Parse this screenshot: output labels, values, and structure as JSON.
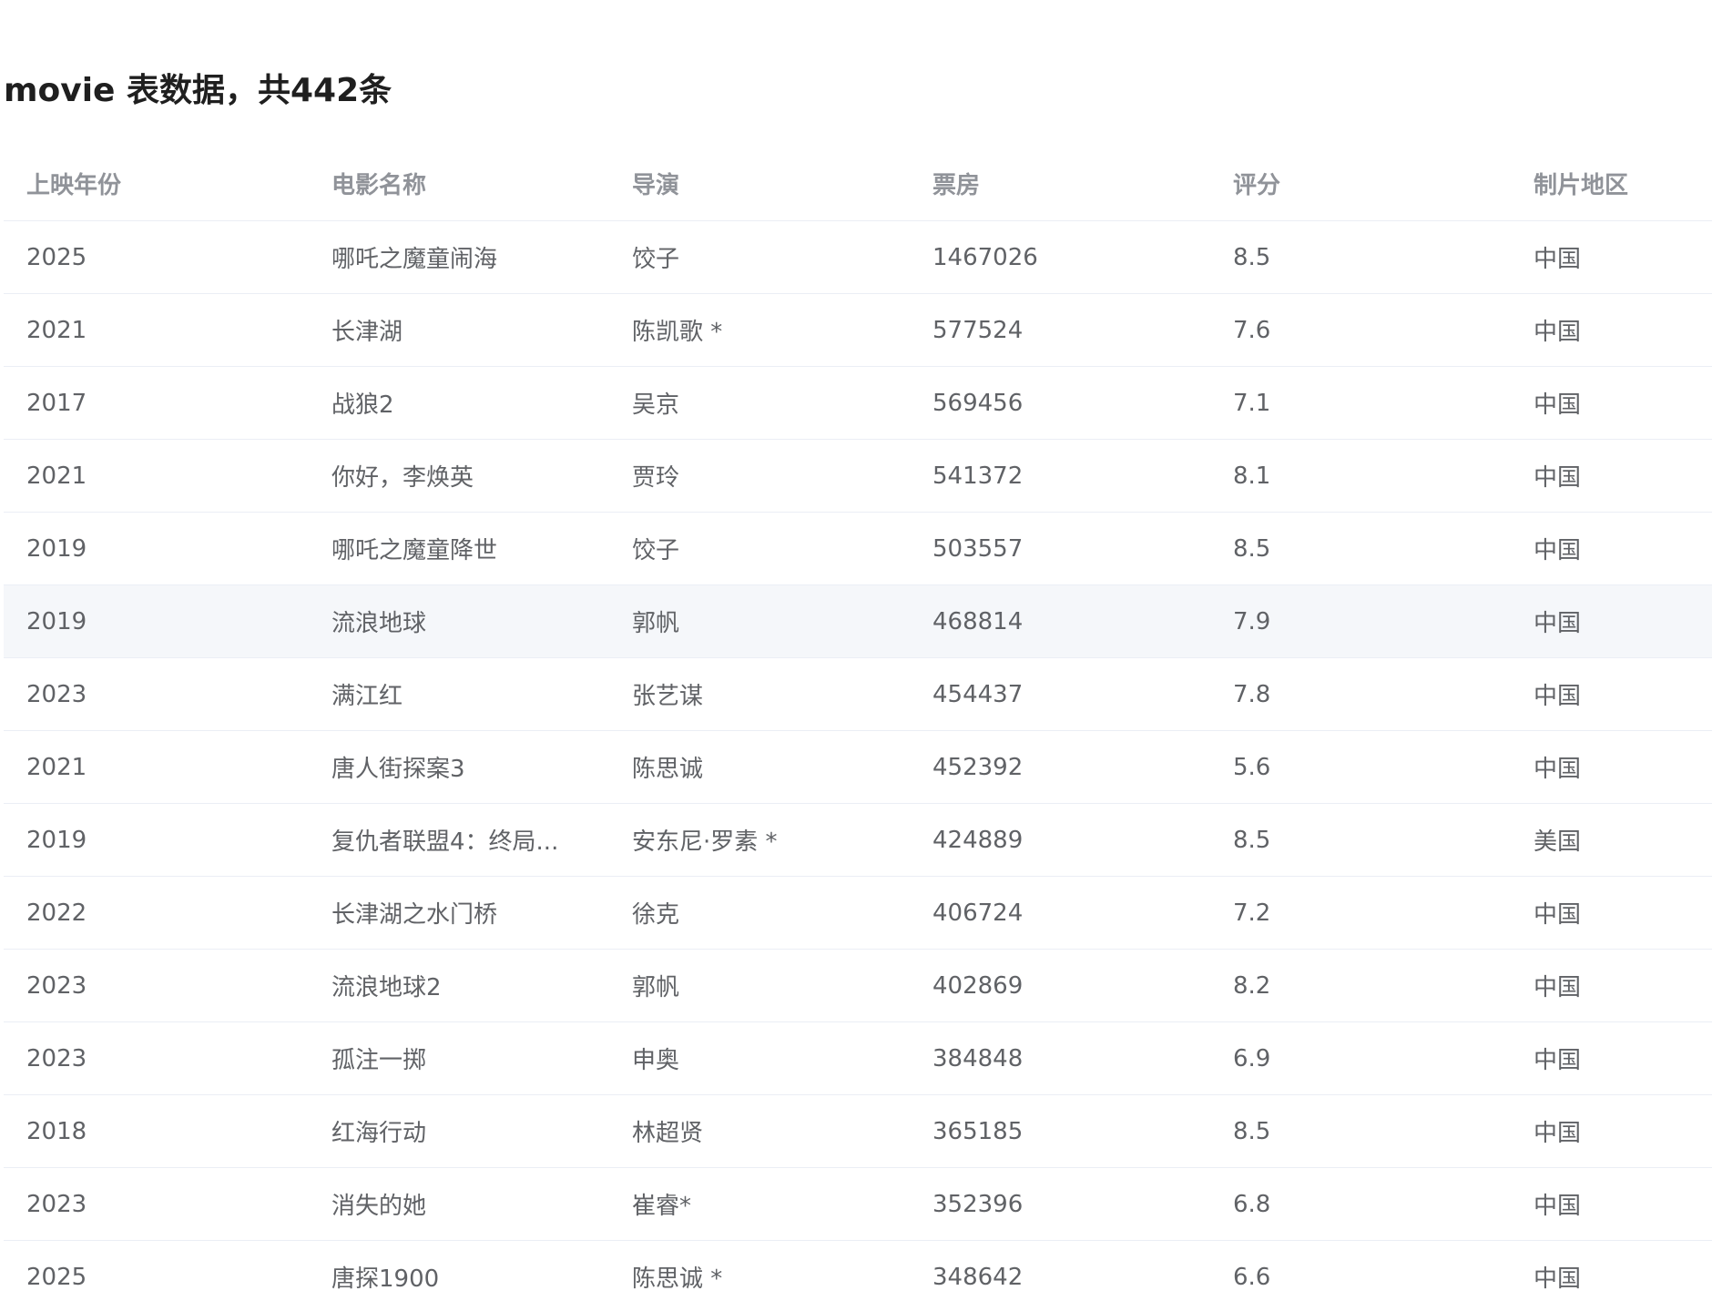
{
  "page": {
    "title": "movie 表数据，共442条"
  },
  "table": {
    "columns": [
      "上映年份",
      "电影名称",
      "导演",
      "票房",
      "评分",
      "制片地区"
    ],
    "rows": [
      [
        "2025",
        "哪吒之魔童闹海",
        "饺子",
        "1467026",
        "8.5",
        "中国"
      ],
      [
        "2021",
        "长津湖",
        "陈凯歌 *",
        "577524",
        "7.6",
        "中国"
      ],
      [
        "2017",
        "战狼2",
        "吴京",
        "569456",
        "7.1",
        "中国"
      ],
      [
        "2021",
        "你好，李焕英",
        "贾玲",
        "541372",
        "8.1",
        "中国"
      ],
      [
        "2019",
        "哪吒之魔童降世",
        "饺子",
        "503557",
        "8.5",
        "中国"
      ],
      [
        "2019",
        "流浪地球",
        "郭帆",
        "468814",
        "7.9",
        "中国"
      ],
      [
        "2023",
        "满江红",
        "张艺谋",
        "454437",
        "7.8",
        "中国"
      ],
      [
        "2021",
        "唐人街探案3",
        "陈思诚",
        "452392",
        "5.6",
        "中国"
      ],
      [
        "2019",
        "复仇者联盟4：终局...",
        "安东尼·罗素 *",
        "424889",
        "8.5",
        "美国"
      ],
      [
        "2022",
        "长津湖之水门桥",
        "徐克",
        "406724",
        "7.2",
        "中国"
      ],
      [
        "2023",
        "流浪地球2",
        "郭帆",
        "402869",
        "8.2",
        "中国"
      ],
      [
        "2023",
        "孤注一掷",
        "申奥",
        "384848",
        "6.9",
        "中国"
      ],
      [
        "2018",
        "红海行动",
        "林超贤",
        "365185",
        "8.5",
        "中国"
      ],
      [
        "2023",
        "消失的她",
        "崔睿*",
        "352396",
        "6.8",
        "中国"
      ],
      [
        "2025",
        "唐探1900",
        "陈思诚 *",
        "348642",
        "6.6",
        "中国"
      ]
    ],
    "hovered_row": 5,
    "colors": {
      "header_text": "#909399",
      "cell_text": "#606266",
      "border": "#ebeef5",
      "hover_bg": "#f5f7fa"
    }
  }
}
